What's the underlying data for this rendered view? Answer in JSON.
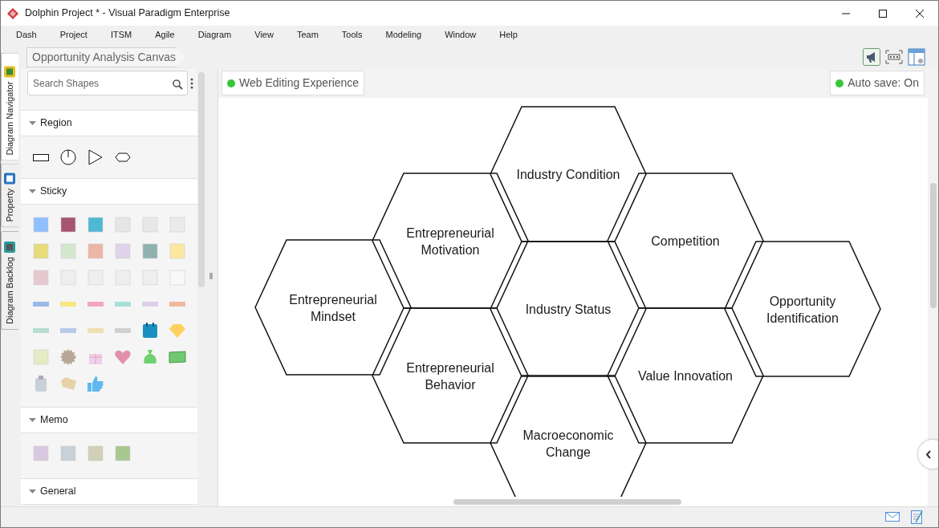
{
  "window": {
    "title": "Dolphin Project * - Visual Paradigm Enterprise"
  },
  "menu": [
    "Dash",
    "Project",
    "ITSM",
    "Agile",
    "Diagram",
    "View",
    "Team",
    "Tools",
    "Modeling",
    "Window",
    "Help"
  ],
  "side_tabs": [
    {
      "label": "Diagram Navigator",
      "selected": true
    },
    {
      "label": "Property",
      "selected": false
    },
    {
      "label": "Diagram Backlog",
      "selected": false
    }
  ],
  "breadcrumb": "Opportunity Analysis Canvas",
  "palette": {
    "search": {
      "placeholder": "Search Shapes"
    },
    "sections": [
      {
        "title": "Region",
        "kind": "region"
      },
      {
        "title": "Sticky",
        "kind": "sticky"
      },
      {
        "title": "Memo",
        "kind": "memo"
      },
      {
        "title": "General",
        "kind": "general"
      }
    ]
  },
  "status_badges": [
    {
      "label": "Web Editing Experience"
    },
    {
      "label": "Auto save: On"
    }
  ],
  "canvas": {
    "hexagons": [
      {
        "lines": [
          "Industry Condition"
        ]
      },
      {
        "lines": [
          "Entrepreneurial",
          "Motivation"
        ]
      },
      {
        "lines": [
          "Competition"
        ]
      },
      {
        "lines": [
          "Entrepreneurial",
          "Mindset"
        ]
      },
      {
        "lines": [
          "Industry Status"
        ]
      },
      {
        "lines": [
          "Opportunity",
          "Identification"
        ]
      },
      {
        "lines": [
          "Entrepreneurial",
          "Behavior"
        ]
      },
      {
        "lines": [
          "Value Innovation"
        ]
      },
      {
        "lines": [
          "Macroeconomic",
          "Change"
        ]
      }
    ]
  }
}
